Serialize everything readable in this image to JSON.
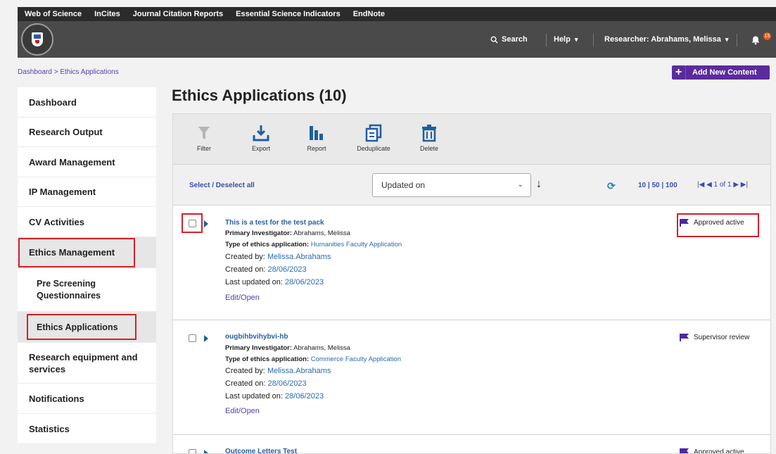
{
  "topnav": [
    "Web of Science",
    "InCites",
    "Journal Citation Reports",
    "Essential Science Indicators",
    "EndNote"
  ],
  "header": {
    "search_label": "Search",
    "help_label": "Help",
    "researcher_label": "Researcher: Abrahams, Melissa",
    "notification_count": "15",
    "dropdown_glyph": "▾"
  },
  "breadcrumb": "Dashboard > Ethics Applications",
  "add_button": {
    "plus": "+",
    "label": "Add New Content"
  },
  "sidebar": {
    "items": [
      "Dashboard",
      "Research Output",
      "Award Management",
      "IP Management",
      "CV Activities",
      "Ethics Management",
      "Pre Screening Questionnaires",
      "Ethics Applications",
      "Research equipment and services",
      "Notifications",
      "Statistics"
    ]
  },
  "page_title": "Ethics Applications (10)",
  "toolbar": {
    "filter": "Filter",
    "export": "Export",
    "report": "Report",
    "deduplicate": "Deduplicate",
    "delete": "Delete"
  },
  "controls": {
    "select_all": "Select / Deselect all",
    "sort_value": "Updated on",
    "sort_chevron": "⌄",
    "sort_direction": "↓",
    "refresh_glyph": "⟳",
    "page_sizes": "10 | 50 | 100",
    "pager": "|◀ ◀ 1 of 1 ▶ ▶|"
  },
  "labels": {
    "primary_investigator": "Primary Investigator:",
    "type_of_application": "Type of ethics application:",
    "created_by": "Created by:",
    "created_on": "Created on:",
    "last_updated_on": "Last updated on:",
    "edit_open": "Edit/Open"
  },
  "records": [
    {
      "title": "This is a test for the test pack",
      "investigator": "Abrahams, Melissa",
      "type": "Humanities Faculty Application",
      "created_by": "Melissa.Abrahams",
      "created_on": "28/06/2023",
      "updated_on": "28/06/2023",
      "status": "Approved active"
    },
    {
      "title": "ougbihbvihybvi-hb",
      "investigator": "Abrahams, Melissa",
      "type": "Commerce Faculty Application",
      "created_by": "Melissa.Abrahams",
      "created_on": "28/06/2023",
      "updated_on": "28/06/2023",
      "status": "Supervisor review"
    },
    {
      "title": "Outcome Letters Test",
      "status": "Approved active"
    }
  ],
  "colors": {
    "accent_purple": "#5b2b9e",
    "link_blue": "#2a6ab0",
    "highlight_red": "#d4202a",
    "header_dark": "#4a4a4a"
  }
}
